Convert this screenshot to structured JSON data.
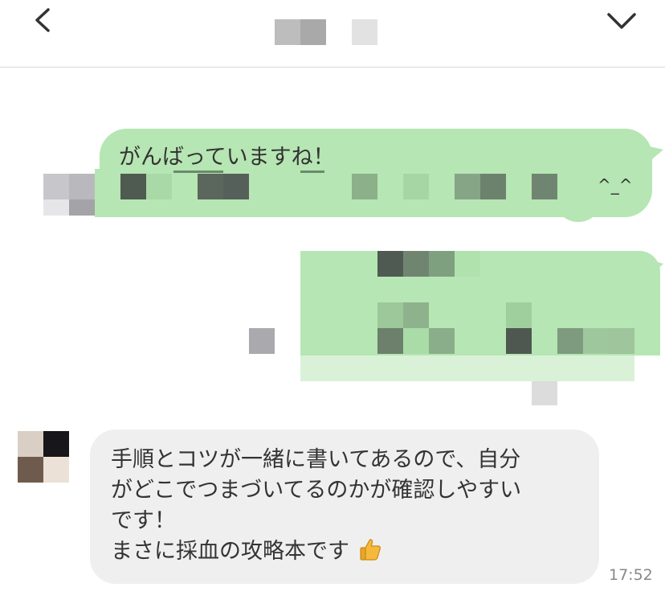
{
  "chat": {
    "messages": [
      {
        "side": "sent",
        "text_line1": "がんばっていますね！",
        "text_line2_end": "^_^"
      },
      {
        "side": "sent",
        "obscured": true
      },
      {
        "side": "received",
        "lines": [
          "手順とコツが一緒に書いてあるので、自分",
          "がどこでつまづいてるのかが確認しやすい",
          "です！",
          "まさに採血の攻略本です"
        ],
        "emoji": "thumbs-up",
        "time": "17:52"
      }
    ]
  },
  "icons": {
    "back": "chevron-left-icon",
    "collapse": "chevron-down-icon",
    "thumbs_up": "thumbs-up-icon"
  },
  "colors": {
    "sent_bubble": "#b6e6b3",
    "received_bubble": "#efefef",
    "header_border": "#d8d8d8",
    "timestamp": "#888888"
  }
}
